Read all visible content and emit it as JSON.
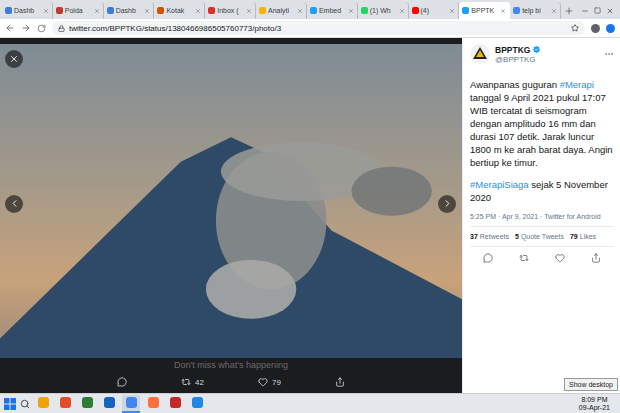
{
  "browser": {
    "tabs": [
      {
        "label": "Dashb",
        "selected": false,
        "color": "#3b7dd8"
      },
      {
        "label": "Polda",
        "selected": false,
        "color": "#c0392b"
      },
      {
        "label": "Dashb",
        "selected": false,
        "color": "#3b7dd8"
      },
      {
        "label": "Kotak",
        "selected": false,
        "color": "#d35400"
      },
      {
        "label": "Inbox (",
        "selected": false,
        "color": "#d93025"
      },
      {
        "label": "Analyti",
        "selected": false,
        "color": "#f4b400"
      },
      {
        "label": "Embed",
        "selected": false,
        "color": "#1da1f2"
      },
      {
        "label": "(1) Wh",
        "selected": false,
        "color": "#25d366"
      },
      {
        "label": "(4)",
        "selected": false,
        "color": "#ff0000"
      },
      {
        "label": "BPPTK",
        "selected": true,
        "color": "#1da1f2"
      },
      {
        "label": "telp bi",
        "selected": false,
        "color": "#4285f4"
      }
    ],
    "url": "twitter.com/BPPTKG/status/1380466986505760773/photo/3"
  },
  "viewer": {
    "notice": "Don't miss what's happening",
    "actions": [
      {
        "kind": "reply",
        "count": ""
      },
      {
        "kind": "retweet",
        "count": "42"
      },
      {
        "kind": "like",
        "count": "79"
      },
      {
        "kind": "share",
        "count": ""
      }
    ]
  },
  "tweet": {
    "name": "BPPTKG",
    "verified": true,
    "handle": "@BPPTKG",
    "paragraphs": [
      [
        {
          "kind": "text",
          "text": "Awanpanas guguran "
        },
        {
          "kind": "hashtag",
          "text": "#Merapi"
        },
        {
          "kind": "text",
          "text": " tanggal 9 April 2021 pukul 17:07 WIB tercatat di seismogram dengan amplitudo 16 mm dan durasi 107 detik. Jarak luncur 1800 m ke arah barat daya. Angin bertiup ke timur."
        }
      ],
      [
        {
          "kind": "hashtag",
          "text": "#MerapiSiaga"
        },
        {
          "kind": "text",
          "text": " sejak 5 November 2020"
        }
      ]
    ],
    "meta": "5:25 PM · Apr 9, 2021 · Twitter for Android",
    "stats": [
      {
        "count": "37",
        "label": "Retweets"
      },
      {
        "count": "5",
        "label": "Quote Tweets"
      },
      {
        "count": "79",
        "label": "Likes"
      }
    ],
    "actions": [
      "reply",
      "retweet",
      "like",
      "share"
    ]
  },
  "taskbar": {
    "apps": [
      {
        "color": "#f0a30a",
        "active": false
      },
      {
        "color": "#e34c26",
        "active": false
      },
      {
        "color": "#2e7d32",
        "active": false
      },
      {
        "color": "#1565c0",
        "active": false
      },
      {
        "color": "#4285f4",
        "active": true
      },
      {
        "color": "#ff7139",
        "active": false
      },
      {
        "color": "#c62828",
        "active": false
      },
      {
        "color": "#1e88e5",
        "active": false
      }
    ],
    "tooltip": "Show desktop",
    "time": "8:09 PM",
    "date": "09-Apr-21"
  }
}
